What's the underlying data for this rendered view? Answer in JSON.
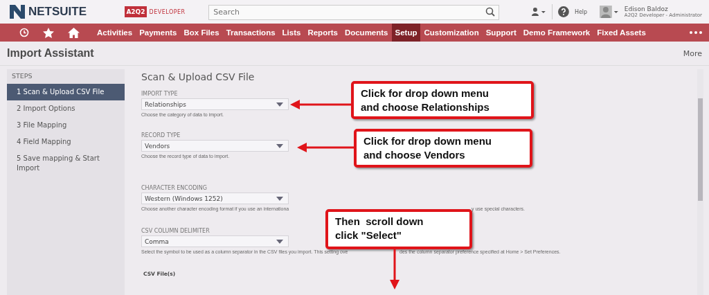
{
  "header": {
    "logo": "NETSUITE",
    "badge_logo": "A2Q2",
    "badge_tagline": "DEVELOPER",
    "search": {
      "placeholder": "Search"
    },
    "help": "Help",
    "user": {
      "name": "Edison Baldoz",
      "role": "A2Q2 Developer - Administrator"
    }
  },
  "nav": [
    {
      "label": "Activities",
      "selected": false
    },
    {
      "label": "Payments",
      "selected": false
    },
    {
      "label": "Box Files",
      "selected": false
    },
    {
      "label": "Transactions",
      "selected": false
    },
    {
      "label": "Lists",
      "selected": false
    },
    {
      "label": "Reports",
      "selected": false
    },
    {
      "label": "Documents",
      "selected": false
    },
    {
      "label": "Setup",
      "selected": true
    },
    {
      "label": "Customization",
      "selected": false
    },
    {
      "label": "Support",
      "selected": false
    },
    {
      "label": "Demo Framework",
      "selected": false
    },
    {
      "label": "Fixed Assets",
      "selected": false
    }
  ],
  "page_title": "Import Assistant",
  "more": "More",
  "steps": {
    "title": "STEPS",
    "items": [
      {
        "label": "1 Scan & Upload CSV File",
        "selected": true
      },
      {
        "label": "2 Import Options",
        "selected": false
      },
      {
        "label": "3 File Mapping",
        "selected": false
      },
      {
        "label": "4 Field Mapping",
        "selected": false
      },
      {
        "label": "5 Save mapping & Start Import",
        "selected": false
      }
    ]
  },
  "section_title": "Scan & Upload CSV File",
  "fields": [
    {
      "label": "IMPORT TYPE",
      "value": "Relationships",
      "hint": [
        "Choose the category of data to import."
      ]
    },
    {
      "label": "RECORD TYPE",
      "value": "Vendors",
      "hint": [
        "Choose the record type of data to import."
      ]
    },
    {
      "label": "CHARACTER ENCODING",
      "value": "Western (Windows 1252)",
      "hint": [
        "Choose another character encoding format if you use an internationa",
        "y use special characters."
      ]
    },
    {
      "label": "CSV COLUMN DELIMITER",
      "value": "Comma",
      "hint": [
        "Select the symbol to be used as a column separator in the CSV files you import. This setting ove",
        "des the column separator preference specified at Home > Set Preferences."
      ]
    }
  ],
  "csv_files_label": "CSV File(s)",
  "callouts": [
    {
      "lines": [
        "Click for drop down menu",
        "and choose Relationships"
      ]
    },
    {
      "lines": [
        "Click for drop down menu",
        "and choose Vendors"
      ]
    },
    {
      "lines": [
        "Then  scroll down",
        "click \"Select\""
      ]
    }
  ]
}
